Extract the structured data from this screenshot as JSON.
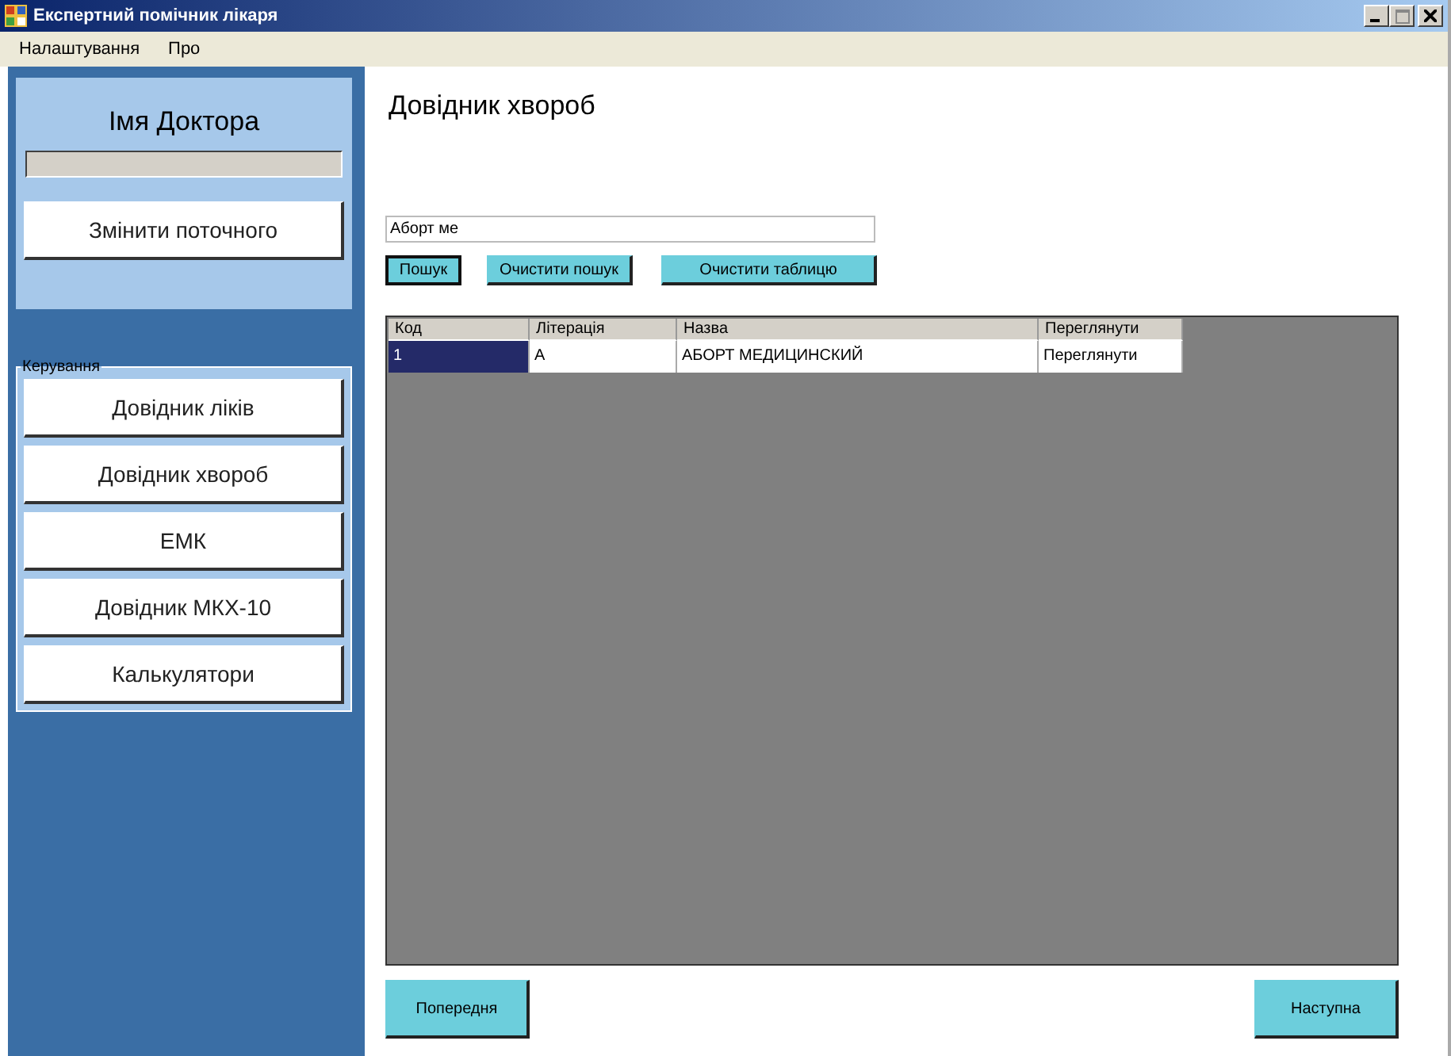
{
  "window": {
    "title": "Експертний помічник лікаря"
  },
  "menu": [
    "Налаштування",
    "Про"
  ],
  "doctor_panel": {
    "title": "Імя Доктора",
    "change_button": "Змінити поточного"
  },
  "control_group": {
    "title": "Керування",
    "buttons": [
      "Довідник ліків",
      "Довідник хвороб",
      "ЕМК",
      "Довідник МКХ-10",
      "Калькулятори"
    ]
  },
  "page_title": "Довідник хвороб",
  "search": {
    "value": "Аборт ме"
  },
  "search_buttons": [
    {
      "label": "Пошук",
      "focused": true
    },
    {
      "label": "Очистити пошук",
      "focused": false
    },
    {
      "label": "Очистити таблицю",
      "focused": false
    }
  ],
  "table": {
    "columns": [
      "Код",
      "Літерація",
      "Назва",
      "Переглянути"
    ],
    "rows": [
      {
        "cells": [
          "1",
          "А",
          "АБОРТ МЕДИЦИНСКИЙ",
          "Переглянути"
        ],
        "selected": true
      }
    ]
  },
  "nav_buttons": [
    "Попередня",
    "Наступна"
  ]
}
